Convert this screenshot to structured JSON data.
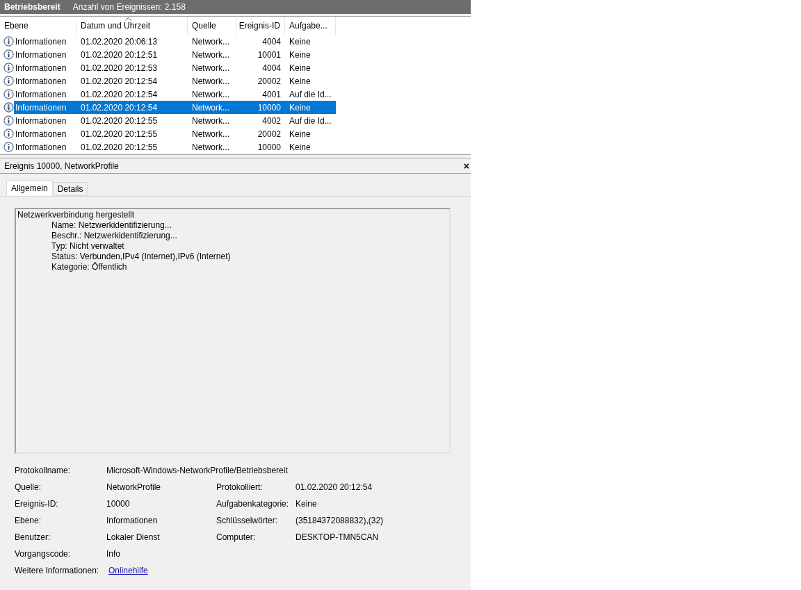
{
  "header": {
    "title": "Betriebsbereit",
    "count": "Anzahl von Ereignissen: 2.158"
  },
  "table": {
    "columns": [
      {
        "label": "Ebene",
        "sorted": false
      },
      {
        "label": "Datum und Uhrzeit",
        "sorted": true
      },
      {
        "label": "Quelle",
        "sorted": false
      },
      {
        "label": "Ereignis-ID",
        "sorted": false
      },
      {
        "label": "Aufgabe...",
        "sorted": false
      }
    ],
    "rows": [
      {
        "cells": [
          "Informationen",
          "01.02.2020 20:06:13",
          "Network...",
          "4004",
          "Keine"
        ],
        "selected": false
      },
      {
        "cells": [
          "Informationen",
          "01.02.2020 20:12:51",
          "Network...",
          "10001",
          "Keine"
        ],
        "selected": false
      },
      {
        "cells": [
          "Informationen",
          "01.02.2020 20:12:53",
          "Network...",
          "4004",
          "Keine"
        ],
        "selected": false
      },
      {
        "cells": [
          "Informationen",
          "01.02.2020 20:12:54",
          "Network...",
          "20002",
          "Keine"
        ],
        "selected": false
      },
      {
        "cells": [
          "Informationen",
          "01.02.2020 20:12:54",
          "Network...",
          "4001",
          "Auf die Id..."
        ],
        "selected": false
      },
      {
        "cells": [
          "Informationen",
          "01.02.2020 20:12:54",
          "Network...",
          "10000",
          "Keine"
        ],
        "selected": true
      },
      {
        "cells": [
          "Informationen",
          "01.02.2020 20:12:55",
          "Network...",
          "4002",
          "Auf die Id..."
        ],
        "selected": false
      },
      {
        "cells": [
          "Informationen",
          "01.02.2020 20:12:55",
          "Network...",
          "20002",
          "Keine"
        ],
        "selected": false
      },
      {
        "cells": [
          "Informationen",
          "01.02.2020 20:12:55",
          "Network...",
          "10000",
          "Keine"
        ],
        "selected": false
      }
    ]
  },
  "detail": {
    "title": "Ereignis 10000, NetworkProfile",
    "close": "×",
    "tabs": [
      {
        "label": "Allgemein",
        "selected": true
      },
      {
        "label": "Details",
        "selected": false
      }
    ],
    "description": {
      "title": "Netzwerkverbindung hergestellt",
      "lines": [
        "Name: Netzwerkidentifizierung...",
        "Beschr.: Netzwerkidentifizierung...",
        "Typ: Nicht verwaltet",
        "Status: Verbunden,IPv4 (Internet),IPv6 (Internet)",
        "Kategorie: Öffentlich"
      ]
    },
    "fields": [
      [
        {
          "label": "Protokollname:",
          "value": "Microsoft-Windows-NetworkProfile/Betriebsbereit"
        }
      ],
      [
        {
          "label": "Quelle:",
          "value": "NetworkProfile"
        },
        {
          "label": "Protokolliert:",
          "value": "01.02.2020 20:12:54"
        }
      ],
      [
        {
          "label": "Ereignis-ID:",
          "value": "10000"
        },
        {
          "label": "Aufgabenkategorie:",
          "value": "Keine"
        }
      ],
      [
        {
          "label": "Ebene:",
          "value": "Informationen"
        },
        {
          "label": "Schlüsselwörter:",
          "value": "(35184372088832),(32)"
        }
      ],
      [
        {
          "label": "Benutzer:",
          "value": "Lokaler Dienst"
        },
        {
          "label": "Computer:",
          "value": "DESKTOP-TMN5CAN"
        }
      ],
      [
        {
          "label": "Vorgangscode:",
          "value": "Info"
        }
      ],
      [
        {
          "label": "Weitere Informationen:",
          "value": "Onlinehilfe",
          "kind": "link"
        }
      ]
    ]
  }
}
